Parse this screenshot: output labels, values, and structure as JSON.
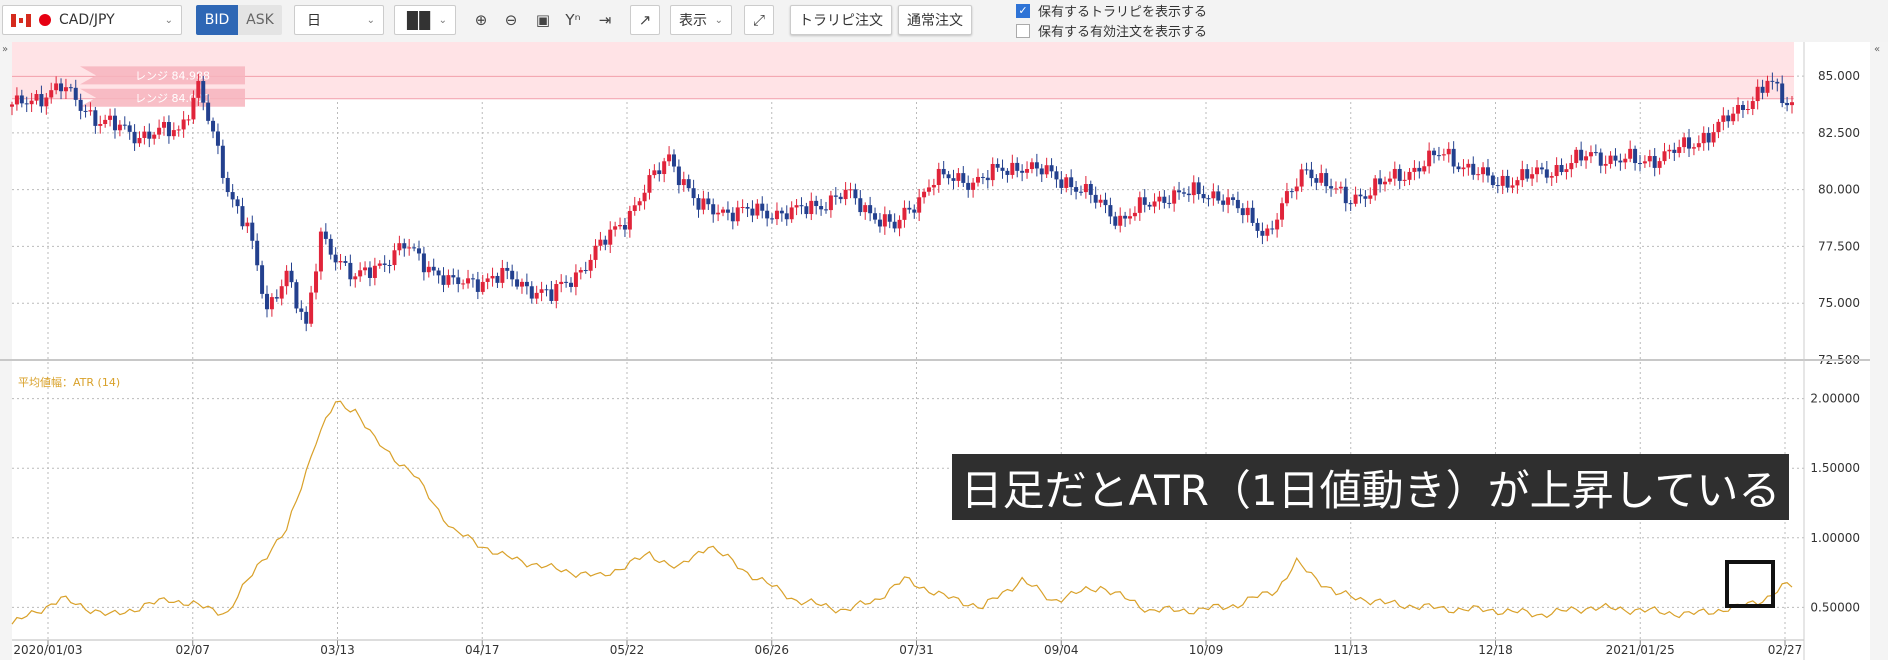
{
  "toolbar": {
    "symbol": "CAD/JPY",
    "bid_label": "BID",
    "ask_label": "ASK",
    "timeframe": "日",
    "display_label": "表示",
    "trail_order_label": "トラリピ注文",
    "normal_order_label": "通常注文",
    "show_trail_label": "保有するトラリピを表示する",
    "show_orders_label": "保有する有効注文を表示する",
    "show_trail_checked": true,
    "show_orders_checked": false
  },
  "colors": {
    "up": "#e0243a",
    "down": "#23408e",
    "atr": "#d9a12a",
    "range_band": "#ffe3e6"
  },
  "range_labels": [
    "レンジ 84.988",
    "レンジ 84.000"
  ],
  "callout": {
    "text": "日足だとATR（1日値動き）が上昇している"
  },
  "chart_data": [
    {
      "type": "candlestick",
      "title": "",
      "x_labels": [
        "2020/01/03",
        "02/07",
        "03/13",
        "04/17",
        "05/22",
        "06/26",
        "07/31",
        "09/04",
        "10/09",
        "11/13",
        "12/18",
        "2021/01/25",
        "02/27"
      ],
      "y_ticks": [
        "85.000",
        "82.500",
        "80.000",
        "77.500",
        "75.000",
        "72.500"
      ],
      "ylim": [
        72.5,
        86.5
      ],
      "range_band": [
        84.0,
        84.988
      ],
      "anchors": [
        [
          0,
          83.6
        ],
        [
          10,
          84.5
        ],
        [
          18,
          83.0
        ],
        [
          26,
          82.4
        ],
        [
          34,
          82.6
        ],
        [
          38,
          84.6
        ],
        [
          44,
          80.0
        ],
        [
          48,
          78.5
        ],
        [
          52,
          74.5
        ],
        [
          56,
          76.5
        ],
        [
          60,
          73.8
        ],
        [
          63,
          78.0
        ],
        [
          70,
          76.0
        ],
        [
          80,
          77.5
        ],
        [
          90,
          75.8
        ],
        [
          100,
          76.2
        ],
        [
          110,
          75.3
        ],
        [
          116,
          76.5
        ],
        [
          126,
          79.0
        ],
        [
          134,
          81.5
        ],
        [
          140,
          79.2
        ],
        [
          150,
          79.0
        ],
        [
          160,
          79.0
        ],
        [
          170,
          79.8
        ],
        [
          180,
          78.3
        ],
        [
          188,
          80.5
        ],
        [
          196,
          80.4
        ],
        [
          206,
          81.1
        ],
        [
          216,
          80.3
        ],
        [
          226,
          78.7
        ],
        [
          236,
          79.8
        ],
        [
          246,
          79.8
        ],
        [
          256,
          78.1
        ],
        [
          264,
          81.0
        ],
        [
          272,
          79.5
        ],
        [
          282,
          80.5
        ],
        [
          292,
          81.6
        ],
        [
          302,
          80.3
        ],
        [
          312,
          80.7
        ],
        [
          322,
          81.5
        ],
        [
          332,
          81.2
        ],
        [
          342,
          81.9
        ],
        [
          352,
          83.4
        ],
        [
          358,
          84.8
        ],
        [
          362,
          83.7
        ]
      ]
    },
    {
      "type": "line",
      "title": "平均値幅：ATR (14)",
      "y_ticks": [
        "2.00000",
        "1.50000",
        "1.00000",
        "0.50000"
      ],
      "ylim": [
        0.28,
        2.22
      ],
      "anchors": [
        [
          0,
          0.38
        ],
        [
          10,
          0.56
        ],
        [
          20,
          0.44
        ],
        [
          32,
          0.56
        ],
        [
          44,
          0.46
        ],
        [
          50,
          0.8
        ],
        [
          56,
          1.05
        ],
        [
          62,
          1.7
        ],
        [
          66,
          1.97
        ],
        [
          70,
          1.92
        ],
        [
          74,
          1.7
        ],
        [
          82,
          1.45
        ],
        [
          90,
          1.05
        ],
        [
          100,
          0.87
        ],
        [
          110,
          0.78
        ],
        [
          120,
          0.72
        ],
        [
          130,
          0.88
        ],
        [
          136,
          0.78
        ],
        [
          142,
          0.95
        ],
        [
          150,
          0.75
        ],
        [
          160,
          0.55
        ],
        [
          170,
          0.48
        ],
        [
          176,
          0.55
        ],
        [
          182,
          0.7
        ],
        [
          190,
          0.58
        ],
        [
          198,
          0.5
        ],
        [
          206,
          0.7
        ],
        [
          212,
          0.55
        ],
        [
          222,
          0.65
        ],
        [
          232,
          0.48
        ],
        [
          242,
          0.48
        ],
        [
          250,
          0.52
        ],
        [
          258,
          0.63
        ],
        [
          262,
          0.82
        ],
        [
          270,
          0.6
        ],
        [
          280,
          0.53
        ],
        [
          292,
          0.49
        ],
        [
          302,
          0.48
        ],
        [
          312,
          0.45
        ],
        [
          322,
          0.5
        ],
        [
          332,
          0.48
        ],
        [
          342,
          0.45
        ],
        [
          352,
          0.5
        ],
        [
          358,
          0.57
        ],
        [
          362,
          0.66
        ]
      ]
    }
  ]
}
